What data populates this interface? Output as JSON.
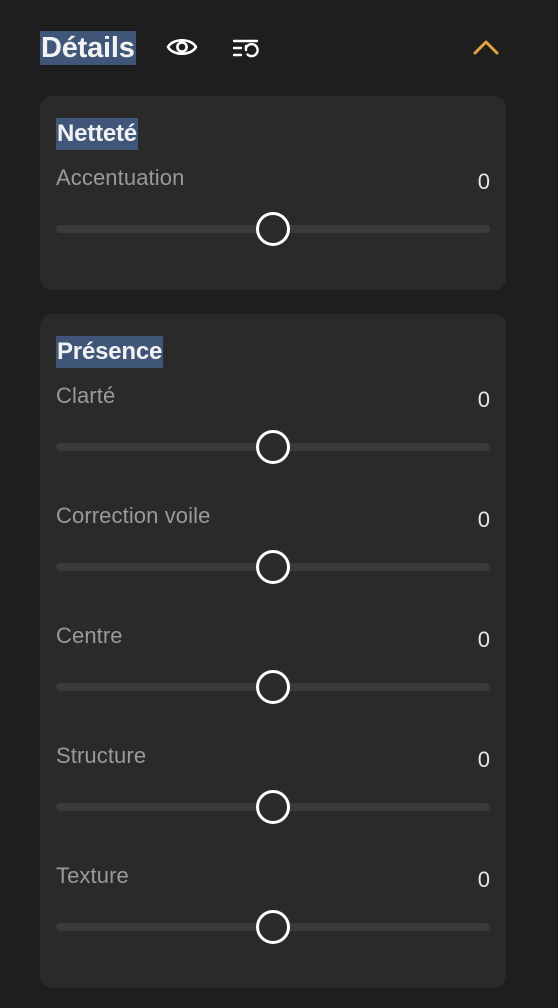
{
  "header": {
    "title": "Détails",
    "visibility_icon": "eye-icon",
    "reset_icon": "list-reset-icon",
    "collapse_icon": "chevron-up-icon",
    "accent_color": "#e3a33a",
    "highlight_color": "#3f5678"
  },
  "sections": [
    {
      "title": "Netteté",
      "sliders": [
        {
          "label": "Accentuation",
          "value": "0",
          "position": 0.5
        }
      ]
    },
    {
      "title": "Présence",
      "sliders": [
        {
          "label": "Clarté",
          "value": "0",
          "position": 0.5
        },
        {
          "label": "Correction voile",
          "value": "0",
          "position": 0.5
        },
        {
          "label": "Centre",
          "value": "0",
          "position": 0.5
        },
        {
          "label": "Structure",
          "value": "0",
          "position": 0.5
        },
        {
          "label": "Texture",
          "value": "0",
          "position": 0.5
        }
      ]
    }
  ]
}
